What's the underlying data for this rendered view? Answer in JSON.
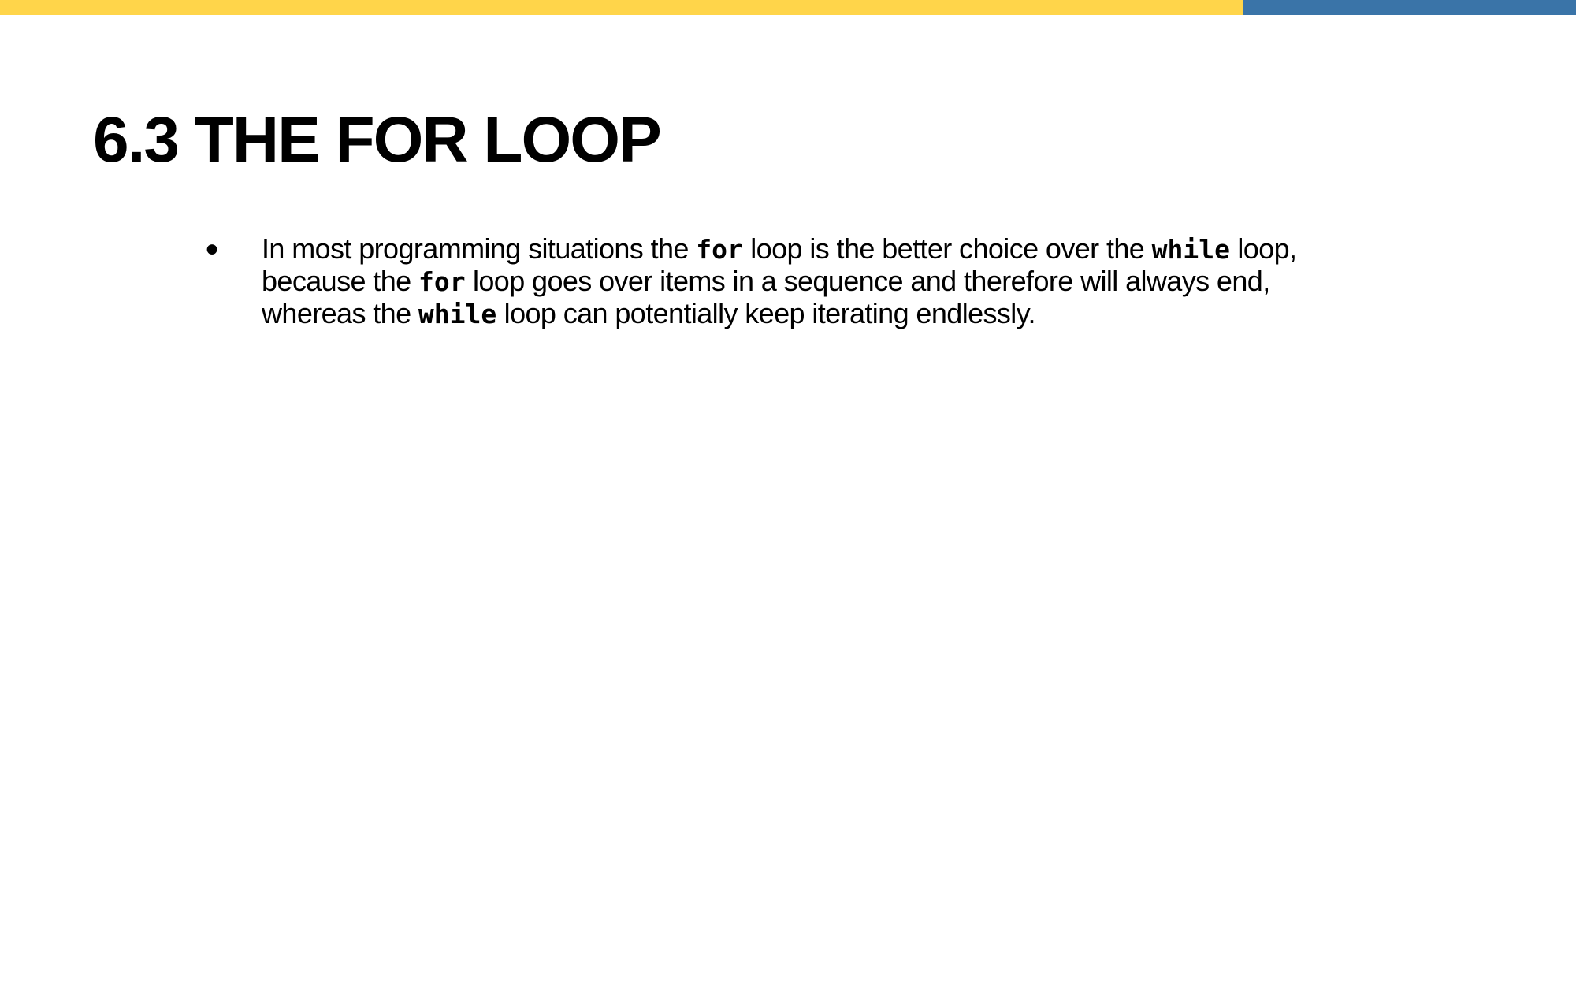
{
  "colors": {
    "top_bar_primary": "#ffd54a",
    "top_bar_secondary": "#3a74a8"
  },
  "slide": {
    "title": "6.3 THE FOR LOOP",
    "bullets": [
      {
        "marker": "●",
        "segments": [
          {
            "type": "text",
            "text": "In most programming situations the "
          },
          {
            "type": "code",
            "text": "for"
          },
          {
            "type": "text",
            "text": " loop is the better choice over the "
          },
          {
            "type": "code",
            "text": "while"
          },
          {
            "type": "text",
            "text": " loop, because the "
          },
          {
            "type": "code",
            "text": "for"
          },
          {
            "type": "text",
            "text": " loop goes over items in a sequence and therefore will always end, whereas the "
          },
          {
            "type": "code",
            "text": "while"
          },
          {
            "type": "text",
            "text": " loop can potentially keep iterating endlessly."
          }
        ]
      }
    ]
  }
}
